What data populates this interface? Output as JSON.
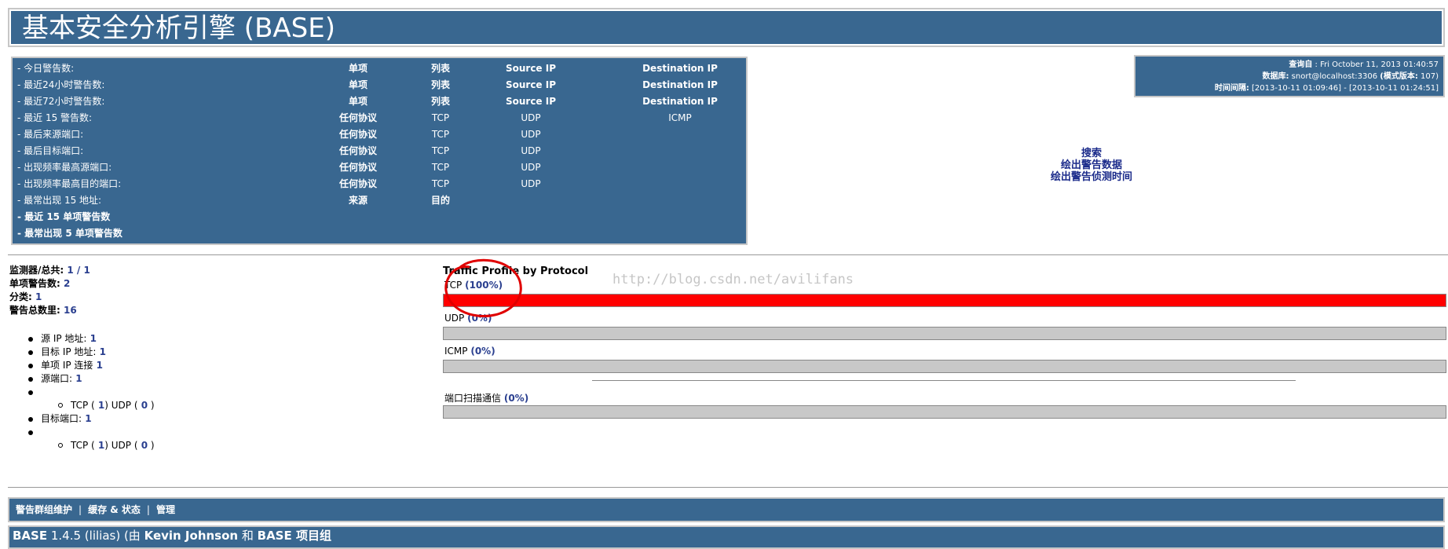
{
  "title": "基本安全分析引擎  (BASE)",
  "stats": {
    "rows": [
      {
        "label": "- 今日警告数:",
        "c1": "单项",
        "c2": "列表",
        "c3": "Source IP",
        "c4": "Destination IP"
      },
      {
        "label": "- 最近24小时警告数:",
        "c1": "单项",
        "c2": "列表",
        "c3": "Source IP",
        "c4": "Destination IP"
      },
      {
        "label": "- 最近72小时警告数:",
        "c1": "单项",
        "c2": "列表",
        "c3": "Source IP",
        "c4": "Destination IP"
      },
      {
        "label": "- 最近  15 警告数:",
        "c1": "任何协议",
        "c2": "TCP",
        "c3": "UDP",
        "c4": "ICMP"
      },
      {
        "label": "- 最后来源端口:",
        "c1": "任何协议",
        "c2": "TCP",
        "c3": "UDP",
        "c4": ""
      },
      {
        "label": "- 最后目标端口:",
        "c1": "任何协议",
        "c2": "TCP",
        "c3": "UDP",
        "c4": ""
      },
      {
        "label": "- 出现频率最高源端口:",
        "c1": "任何协议",
        "c2": "TCP",
        "c3": "UDP",
        "c4": ""
      },
      {
        "label": "- 出现频率最高目的端口:",
        "c1": "任何协议",
        "c2": "TCP",
        "c3": "UDP",
        "c4": ""
      },
      {
        "label": "- 最常出现  15 地址:",
        "c1": "来源",
        "c2": "目的",
        "c3": "",
        "c4": ""
      }
    ],
    "bold_rows": [
      "- 最近  15 单项警告数",
      "- 最常出现  5 单项警告数"
    ]
  },
  "query": {
    "line1_key": "查询自",
    "line1_val": " : Fri October 11, 2013 01:40:57",
    "line2_key": "数据库:",
    "line2_val": " snort@localhost:3306   ",
    "line2_key2": "(模式版本:",
    "line2_val2": " 107)",
    "line3_key": "时间间隔:",
    "line3_val": " [2013-10-11 01:09:46] - [2013-10-11 01:24:51]"
  },
  "links": {
    "search": "搜索",
    "graph_data": "绘出警告数据",
    "graph_time": "绘出警告侦测时间"
  },
  "sensor": {
    "sensors_label": "监测器/总共:",
    "sensors_val": " 1 / 1",
    "unique_label": "单项警告数:",
    "unique_val": " 2",
    "cat_label": "分类:",
    "cat_val": " 1",
    "total_label": "警告总数里:",
    "total_val": " 16"
  },
  "details": {
    "src_ip_label": "源  IP 地址:",
    "src_ip_val": " 1",
    "dst_ip_label": "目标  IP 地址:",
    "dst_ip_val": " 1",
    "unique_ip_label": "单项  IP 连接",
    "unique_ip_val": " 1",
    "src_port_label": "源端口:",
    "src_port_val": " 1",
    "src_tcp_label": "TCP (",
    "src_tcp_val": " 1",
    "src_udp_label": ")  UDP (",
    "src_udp_val": " 0",
    "close": " )",
    "dst_port_label": "目标端口:",
    "dst_port_val": " 1",
    "dst_tcp_val": " 1",
    "dst_udp_val": " 0"
  },
  "traffic": {
    "title": "Traffic Profile by Protocol",
    "tcp_label": "TCP",
    "tcp_pct": "(100%)",
    "tcp_value": 100,
    "udp_label": "UDP",
    "udp_pct": "(0%)",
    "udp_value": 0,
    "icmp_label": "ICMP",
    "icmp_pct": "(0%)",
    "icmp_value": 0,
    "portscan_label": "端口扫描通信",
    "portscan_pct": "(0%)",
    "portscan_value": 0,
    "fill_color": "#ff0000",
    "annotation_color": "#e00000"
  },
  "watermark": "http://blog.csdn.net/avilifans",
  "bottom_nav": {
    "item1": "警告群组维护",
    "item2": "缓存  & 状态",
    "item3": "管理",
    "sep": "|"
  },
  "footer": {
    "base": "BASE",
    "version": " 1.4.5 (lilias) (由  ",
    "author": "Kevin Johnson",
    "and": " 和  ",
    "team": "BASE 项目组"
  }
}
